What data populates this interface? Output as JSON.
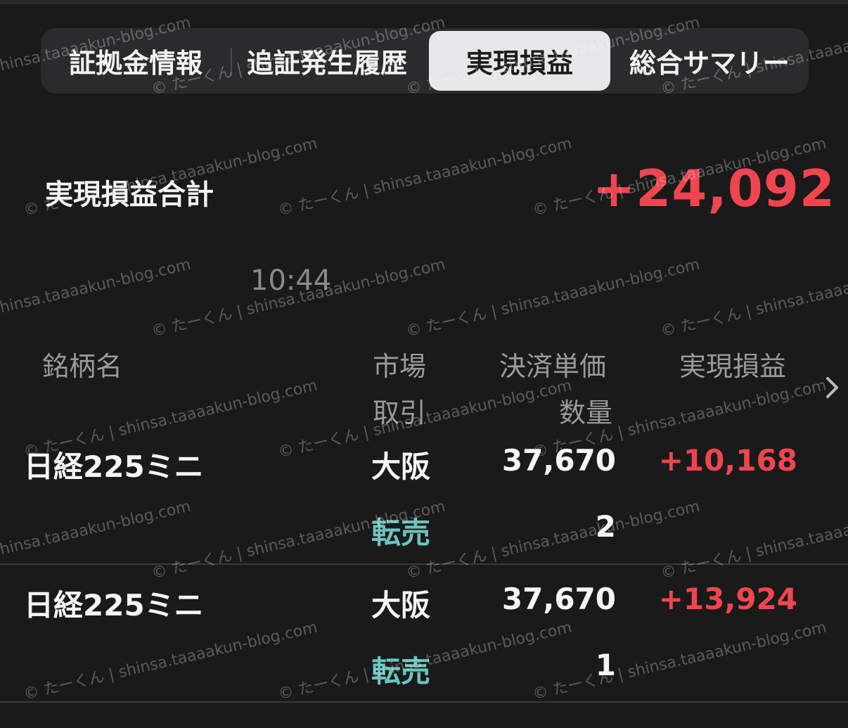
{
  "tabs": [
    {
      "label": "証拠金情報",
      "selected": false
    },
    {
      "label": "追証発生履歴",
      "selected": false
    },
    {
      "label": "実現損益",
      "selected": true
    },
    {
      "label": "総合サマリー",
      "selected": false
    }
  ],
  "summary": {
    "label": "実現損益合計",
    "value": "+24,092"
  },
  "time": "10:44",
  "headers": {
    "name": "銘柄名",
    "market": "市場",
    "price": "決済単価",
    "pl": "実現損益",
    "trade": "取引",
    "qty": "数量"
  },
  "rows": [
    {
      "name": "日経225ミニ",
      "market": "大阪",
      "price": "37,670",
      "pl": "+10,168",
      "trade": "転売",
      "qty": "2"
    },
    {
      "name": "日経225ミニ",
      "market": "大阪",
      "price": "37,670",
      "pl": "+13,924",
      "trade": "転売",
      "qty": "1"
    }
  ],
  "watermark": "© たーくん | shinsa.taaaakun-blog.com",
  "colors": {
    "background": "#1a1a1a",
    "profit": "#f0454f",
    "trade": "#6cc4c0",
    "selected_tab_bg": "#e7e7e9"
  },
  "icons": {
    "more_columns": "chevron-right-icon"
  }
}
